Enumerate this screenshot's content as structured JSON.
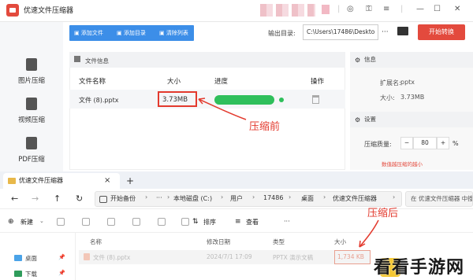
{
  "window": {
    "title": "优速文件压缩器"
  },
  "sidebar": {
    "items": [
      {
        "label": "图片压缩"
      },
      {
        "label": "视频压缩"
      },
      {
        "label": "PDF压缩"
      }
    ]
  },
  "toolbar": {
    "add_file": "添加文件",
    "add_folder": "添加目录",
    "clear_list": "清除列表",
    "output_label": "输出目录:",
    "output_path": "C:\\Users\\17486\\Deskto",
    "more": "···",
    "start": "开始转换"
  },
  "file_panel": {
    "header": "文件信息",
    "columns": [
      "文件名称",
      "大小",
      "进度",
      "操作"
    ],
    "rows": [
      {
        "name": "文件 (8).pptx",
        "size": "3.73MB"
      }
    ]
  },
  "info_panel": {
    "header": "信息",
    "ext_label": "扩展名:",
    "ext_value": "pptx",
    "size_label": "大小:",
    "size_value": "3.73MB"
  },
  "settings_panel": {
    "header": "设置",
    "quality_label": "压缩质量:",
    "quality_minus": "−",
    "quality_value": "80",
    "quality_plus": "+",
    "quality_unit": "%",
    "hint": "数值越压缩的越小"
  },
  "annotations": {
    "before": "压缩前",
    "after": "压缩后"
  },
  "explorer": {
    "tab_title": "优速文件压缩器",
    "tab_close": "×",
    "tab_add": "+",
    "breadcrumb": [
      "开始备份",
      "本地磁盘 (C:)",
      "用户",
      "17486",
      "桌面",
      "优速文件压缩器"
    ],
    "search_placeholder": "在 优速文件压缩器 中搜索",
    "new_label": "新建",
    "sort_label": "排序",
    "view_label": "查看",
    "more": "···",
    "columns": [
      "名称",
      "修改日期",
      "类型",
      "大小"
    ],
    "nav_items": [
      {
        "label": "桌面"
      },
      {
        "label": "下载"
      }
    ],
    "pin": "📌",
    "files": [
      {
        "name": "文件 (8).pptx",
        "date": "2024/7/1 17:09",
        "type": "PPTX 演示文稿",
        "size": "1,734 KB"
      }
    ]
  },
  "watermark": "看看手游网",
  "colors": {
    "accent_red": "#e34a3d",
    "accent_blue": "#3c8ee8",
    "progress_green": "#2fbf5b"
  },
  "progress": {
    "percent": 100
  }
}
